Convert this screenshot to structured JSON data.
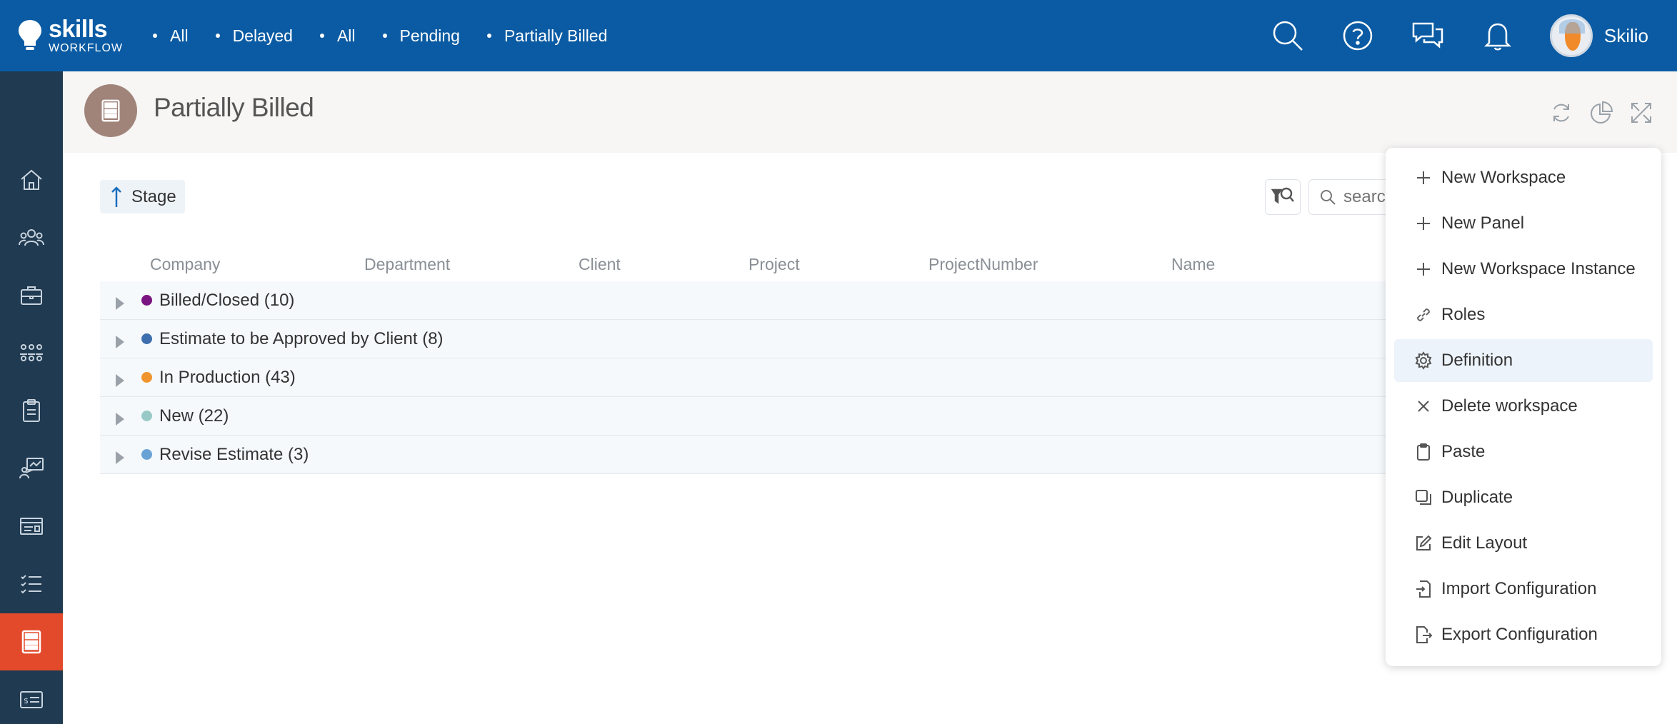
{
  "app": {
    "logo_main": "skills",
    "logo_sub": "WORKFLOW"
  },
  "breadcrumbs": [
    "All",
    "Delayed",
    "All",
    "Pending",
    "Partially Billed"
  ],
  "user": {
    "name": "Skilio"
  },
  "page": {
    "title": "Partially Billed"
  },
  "stage": {
    "label": "Stage"
  },
  "search": {
    "placeholder": "search"
  },
  "columns": [
    "Company",
    "Department",
    "Client",
    "Project",
    "ProjectNumber",
    "Name"
  ],
  "groups": [
    {
      "label": "Billed/Closed (10)",
      "color": "#7a1480"
    },
    {
      "label": "Estimate to be Approved by Client (8)",
      "color": "#3d6fae"
    },
    {
      "label": "In Production (43)",
      "color": "#f0942e"
    },
    {
      "label": "New (22)",
      "color": "#99c9c6"
    },
    {
      "label": "Revise Estimate (3)",
      "color": "#69a3d6"
    }
  ],
  "menu": {
    "items": [
      {
        "label": "New Workspace",
        "icon": "plus-icon"
      },
      {
        "label": "New Panel",
        "icon": "plus-icon"
      },
      {
        "label": "New Workspace Instance",
        "icon": "plus-icon"
      },
      {
        "label": "Roles",
        "icon": "link-icon"
      },
      {
        "label": "Definition",
        "icon": "gear-icon"
      },
      {
        "label": "Delete workspace",
        "icon": "close-icon"
      },
      {
        "label": "Paste",
        "icon": "clipboard-icon"
      },
      {
        "label": "Duplicate",
        "icon": "duplicate-icon"
      },
      {
        "label": "Edit Layout",
        "icon": "edit-icon"
      },
      {
        "label": "Import Configuration",
        "icon": "import-icon"
      },
      {
        "label": "Export Configuration",
        "icon": "export-icon"
      }
    ]
  },
  "colors": {
    "topbar": "#0a5ba3",
    "sidebar": "#1f3a51",
    "active_sidebar": "#e24a2b",
    "header_icon": "#a0847a"
  }
}
